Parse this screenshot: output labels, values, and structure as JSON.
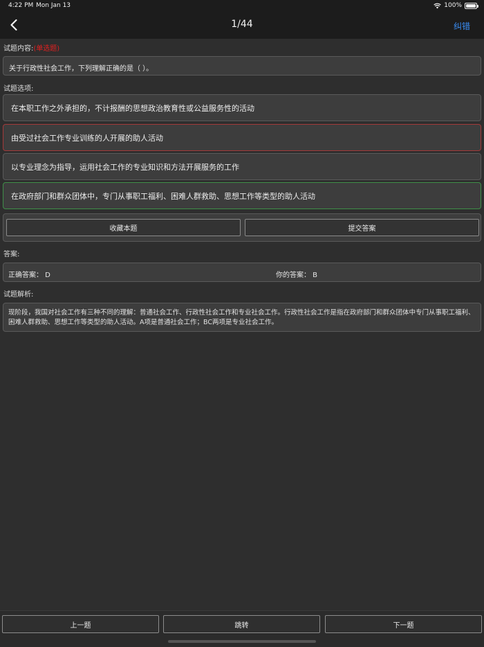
{
  "status": {
    "time": "4:22 PM",
    "date": "Mon Jan 13",
    "battery": "100%",
    "battery_level": 1.0,
    "wifi_icon": "wifi-icon",
    "battery_icon": "battery-icon"
  },
  "nav": {
    "back_icon": "chevron-left-icon",
    "title": "1/44",
    "correct_label": "纠错"
  },
  "question": {
    "section_label": "试题内容:",
    "type_tag": "(单选题)",
    "text": "关于行政性社会工作，下列理解正确的是（      ）。"
  },
  "options": {
    "section_label": "试题选项:",
    "items": [
      {
        "text": "在本职工作之外承担的，不计报酬的思想政治教育性或公益服务性的活动",
        "state": "normal"
      },
      {
        "text": "由受过社会工作专业训练的人开展的助人活动",
        "state": "wrong"
      },
      {
        "text": "以专业理念为指导，运用社会工作的专业知识和方法开展服务的工作",
        "state": "normal"
      },
      {
        "text": "在政府部门和群众团体中，专门从事职工福利、困难人群救助、思想工作等类型的助人活动",
        "state": "correct"
      }
    ]
  },
  "actions": {
    "favorite_label": "收藏本题",
    "submit_label": "提交答案"
  },
  "answer": {
    "section_label": "答案:",
    "correct_answer": "正确答案： D",
    "your_answer": "你的答案： B"
  },
  "explanation": {
    "section_label": "试题解析:",
    "text": "现阶段，我国对社会工作有三种不同的理解：普通社会工作、行政性社会工作和专业社会工作。行政性社会工作是指在政府部门和群众团体中专门从事职工福利、困难人群救助、思想工作等类型的助人活动。A项是普通社会工作；BC两项是专业社会工作。"
  },
  "bottom": {
    "prev_label": "上一题",
    "jump_label": "跳转",
    "next_label": "下一题"
  },
  "colors": {
    "accent": "#3a8ef6",
    "wrong_border": "#a33a3a",
    "correct_border": "#3f8f48",
    "tag_red": "#e02020"
  }
}
